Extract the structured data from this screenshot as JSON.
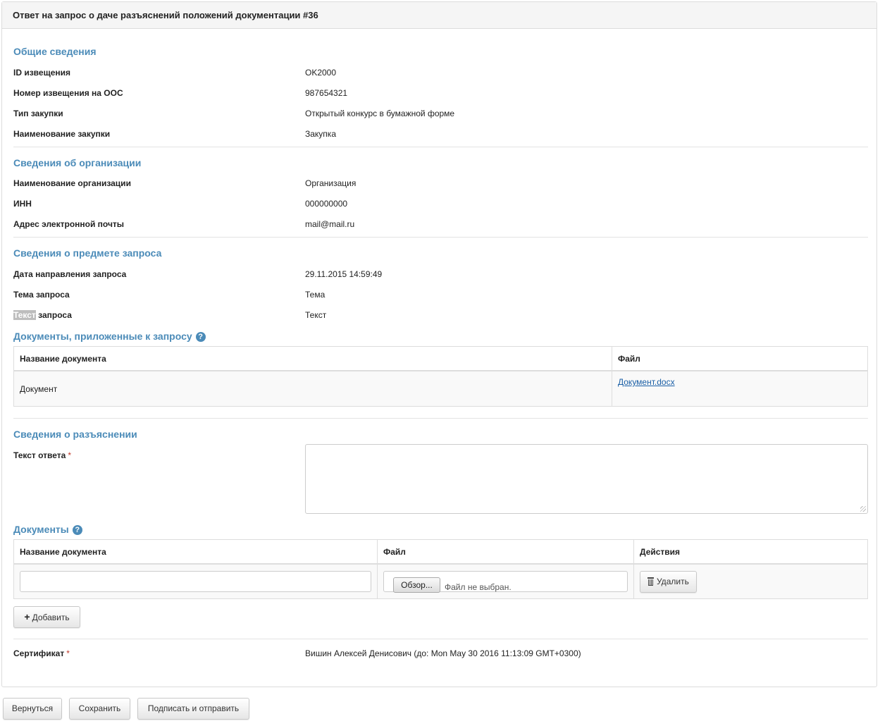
{
  "header": {
    "title": "Ответ на запрос о даче разъяснений положений документации #36"
  },
  "general": {
    "title": "Общие сведения",
    "rows": [
      {
        "label": "ID извещения",
        "value": "OK2000"
      },
      {
        "label": "Номер извещения на ООС",
        "value": "987654321"
      },
      {
        "label": "Тип закупки",
        "value": "Открытый конкурс в бумажной форме"
      },
      {
        "label": "Наименование закупки",
        "value": "Закупка"
      }
    ]
  },
  "organization": {
    "title": "Сведения об организации",
    "rows": [
      {
        "label": "Наименование организации",
        "value": "Организация"
      },
      {
        "label": "ИНН",
        "value": "000000000"
      },
      {
        "label": "Адрес электронной почты",
        "value": "mail@mail.ru"
      }
    ]
  },
  "request": {
    "title": "Сведения о предмете запроса",
    "rows": [
      {
        "label": "Дата направления запроса",
        "value": "29.11.2015 14:59:49"
      },
      {
        "label": "Тема запроса",
        "value": "Тема"
      }
    ],
    "text_label_highlight": "Текст",
    "text_label_rest": " запроса",
    "text_value": "Текст"
  },
  "attached": {
    "title": "Документы, приложенные к запросу",
    "help": "?",
    "col_name": "Название документа",
    "col_file": "Файл",
    "row_name": "Документ",
    "row_file": "Документ.docx"
  },
  "clarification": {
    "title": "Сведения о разъяснении",
    "answer_label": "Текст ответа",
    "required_mark": "*"
  },
  "documents": {
    "title": "Документы",
    "help": "?",
    "col_name": "Название документа",
    "col_file": "Файл",
    "col_actions": "Действия",
    "browse_label": "Обзор...",
    "no_file": "Файл не выбран.",
    "delete_label": "Удалить",
    "add_label": "Добавить",
    "add_symbol": "+"
  },
  "certificate": {
    "label": "Сертификат",
    "required_mark": "*",
    "value": "Вишин Алексей Денисович (до: Mon May 30 2016 11:13:09 GMT+0300)"
  },
  "footer": {
    "back_label": "Вернуться",
    "save_label": "Сохранить",
    "sign_label": "Подписать и отправить"
  }
}
